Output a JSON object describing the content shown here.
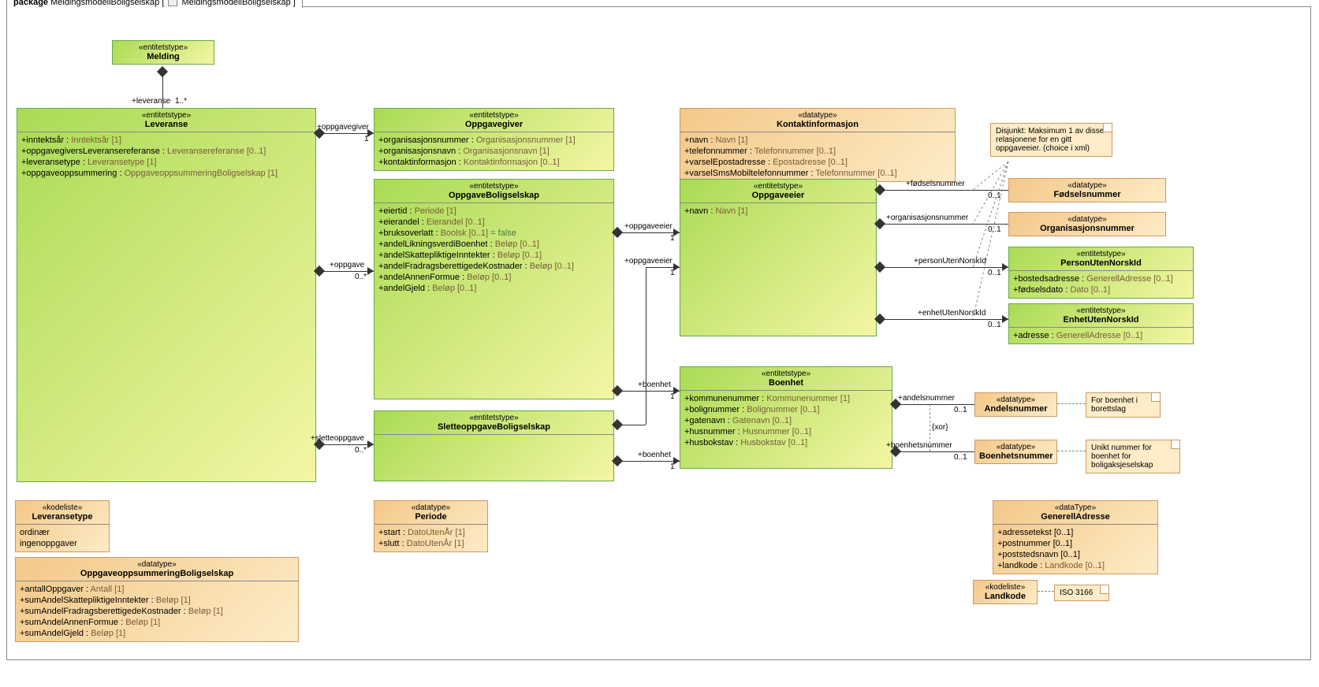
{
  "package": {
    "label": "package",
    "name": "MeldingsmodellBoligselskap",
    "context": "MeldingsmodellBoligselskap"
  },
  "melding": {
    "stereo": "«entitetstype»",
    "name": "Melding"
  },
  "leveranse": {
    "stereo": "«entitetstype»",
    "name": "Leveranse",
    "a1": "+inntektsår",
    "t1": "Inntektsår [1]",
    "a2": "+oppgavegiversLeveransereferanse",
    "t2": "Leveransereferanse [0..1]",
    "a3": "+leveransetype",
    "t3": "Leveransetype [1]",
    "a4": "+oppgaveoppsummering",
    "t4": "OppgaveoppsummeringBoligselskap [1]"
  },
  "oppgavegiver": {
    "stereo": "«entitetstype»",
    "name": "Oppgavegiver",
    "a1": "+organisasjonsnummer",
    "t1": "Organisasjonsnummer [1]",
    "a2": "+organisasjonsnavn",
    "t2": "Organisasjonsnavn [1]",
    "a3": "+kontaktinformasjon",
    "t3": "Kontaktinformasjon [0..1]"
  },
  "kontaktinfo": {
    "stereo": "«datatype»",
    "name": "Kontaktinformasjon",
    "a1": "+navn",
    "t1": "Navn [1]",
    "a2": "+telefonnummer",
    "t2": "Telefonnummer [0..1]",
    "a3": "+varselEpostadresse",
    "t3": "Epostadresse [0..1]",
    "a4": "+varselSmsMobiltelefonnummer",
    "t4": "Telefonnummer [0..1]"
  },
  "oppgave": {
    "stereo": "«entitetstype»",
    "name": "OppgaveBoligselskap",
    "a1": "+eiertid",
    "t1": "Periode [1]",
    "a2": "+eierandel",
    "t2": "Eierandel [0..1]",
    "a3": "+bruksoverlatt",
    "t3": "Boolsk [0..1]",
    "v3": "= false",
    "a4": "+andelLikningsverdiBoenhet",
    "t4": "Beløp [0..1]",
    "a5": "+andelSkattepliktigeInntekter",
    "t5": "Beløp [0..1]",
    "a6": "+andelFradragsberettigedeKostnader",
    "t6": "Beløp [0..1]",
    "a7": "+andelAnnenFormue",
    "t7": "Beløp [0..1]",
    "a8": "+andelGjeld",
    "t8": "Beløp [0..1]"
  },
  "oppgaveeier": {
    "stereo": "«entitetstype»",
    "name": "Oppgaveeier",
    "a1": "+navn",
    "t1": "Navn [1]"
  },
  "slette": {
    "stereo": "«entitetstype»",
    "name": "SletteoppgaveBoligselskap"
  },
  "fodsel": {
    "stereo": "«datatype»",
    "name": "Fødselsnummer"
  },
  "orgnr": {
    "stereo": "«datatype»",
    "name": "Organisasjonsnummer"
  },
  "perUten": {
    "stereo": "«entitetstype»",
    "name": "PersonUtenNorskId",
    "a1": "+bostedsadresse",
    "t1": "GenerellAdresse [0..1]",
    "a2": "+fødselsdato",
    "t2": "Dato [0..1]"
  },
  "enhUten": {
    "stereo": "«entitetstype»",
    "name": "EnhetUtenNorskId",
    "a1": "+adresse",
    "t1": "GenerellAdresse [0..1]"
  },
  "boenhet": {
    "stereo": "«entitetstype»",
    "name": "Boenhet",
    "a1": "+kommunenummer",
    "t1": "Kommunenummer [1]",
    "a2": "+bolignummer",
    "t2": "Bolignummer [0..1]",
    "a3": "+gatenavn",
    "t3": "Gatenavn [0..1]",
    "a4": "+husnummer",
    "t4": "Husnummer [0..1]",
    "a5": "+husbokstav",
    "t5": "Husbokstav [0..1]"
  },
  "andelsnr": {
    "stereo": "«datatype»",
    "name": "Andelsnummer"
  },
  "boenhetnr": {
    "stereo": "«datatype»",
    "name": "Boenhetsnummer"
  },
  "periode": {
    "stereo": "«datatype»",
    "name": "Periode",
    "a1": "+start",
    "t1": "DatoUtenÅr [1]",
    "a2": "+slutt",
    "t2": "DatoUtenÅr [1]"
  },
  "levtype": {
    "stereo": "«kodeliste»",
    "name": "Leveransetype",
    "v1": "ordinær",
    "v2": "ingenoppgaver"
  },
  "oppsum": {
    "stereo": "«datatype»",
    "name": "OppgaveoppsummeringBoligselskap",
    "a1": "+antallOppgaver",
    "t1": "Antall [1]",
    "a2": "+sumAndelSkattepliktigeInntekter",
    "t2": "Beløp [1]",
    "a3": "+sumAndelFradragsberettigedeKostnader",
    "t3": "Beløp [1]",
    "a4": "+sumAndelAnnenFormue",
    "t4": "Beløp [1]",
    "a5": "+sumAndelGjeld",
    "t5": "Beløp [1]"
  },
  "genadresse": {
    "stereo": "«dataType»",
    "name": "GenerellAdresse",
    "a1": "+adressetekst [0..1]",
    "a2": "+postnummer [0..1]",
    "a3": "+poststedsnavn [0..1]",
    "a4": "+landkode",
    "t4": "Landkode [0..1]"
  },
  "landkode": {
    "stereo": "«kodeliste»",
    "name": "Landkode"
  },
  "notes": {
    "disjunkt": "Disjunkt: Maksimum 1 av disse relasjonene for en gitt oppgaveeier. (choice i xml)",
    "boenhet1": "For boenhet i borettslag",
    "boenhet2": "Unikt nummer for boenhet for boligaksjeselskap",
    "iso": "ISO 3166",
    "xor": "{xor}"
  },
  "rels": {
    "leveranse": "+leveranse",
    "m1": "1..*",
    "oppgavegiver": "+oppgavegiver",
    "one": "1",
    "oppgave": "+oppgave",
    "zeroMany": "0..*",
    "sletteoppgave": "+sletteoppgave",
    "oppgaveeier": "+oppgaveeier",
    "boenhet": "+boenhet",
    "fodselnr": "+fødselsnummer",
    "zeroOne": "0..1",
    "orgnr": "+organisasjonsnummer",
    "personUten": "+personUtenNorskId",
    "enhetUten": "+enhetUtenNorskId",
    "andelsnr": "+andelsnummer",
    "boenhetnr": "+boenhetsnummer"
  }
}
